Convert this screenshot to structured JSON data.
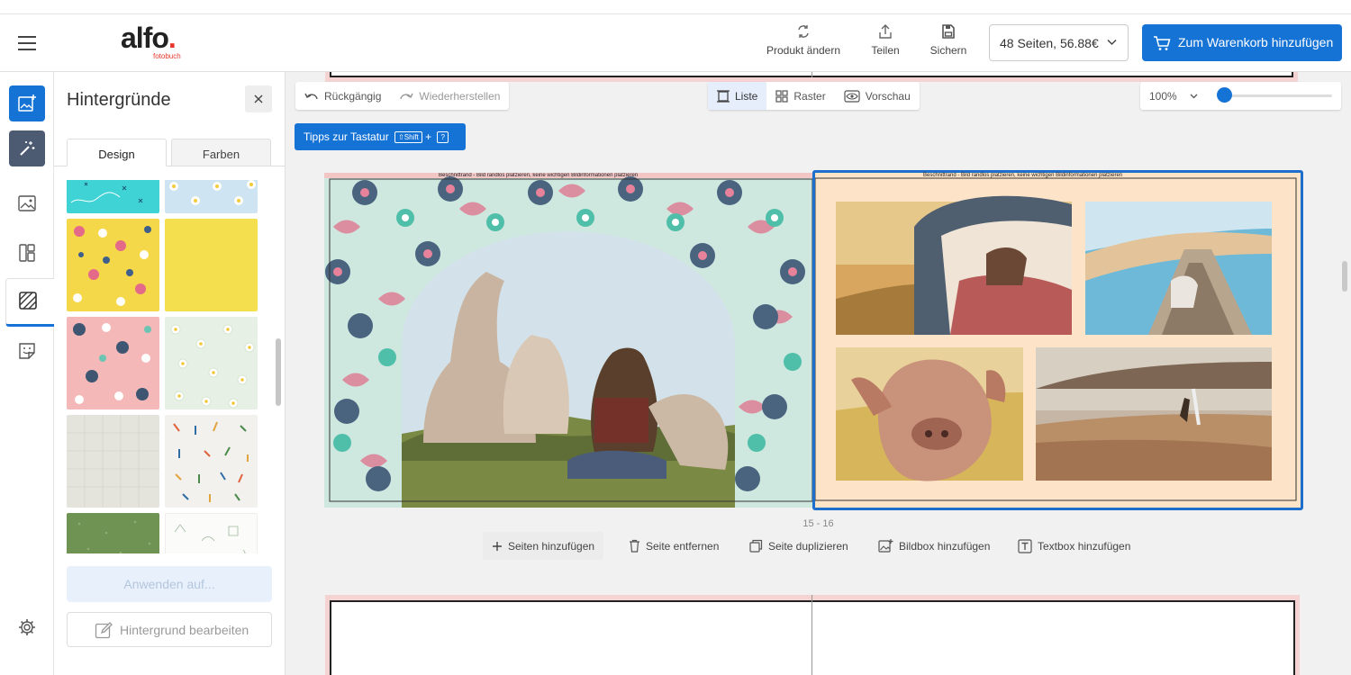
{
  "app": {
    "logo_text": "alfo",
    "logo_dot": ".",
    "logo_sub": "fotobuch"
  },
  "header": {
    "change_product_label": "Produkt ändern",
    "share_label": "Teilen",
    "save_label": "Sichern",
    "pages_price_value": "48 Seiten, 56.88€",
    "add_to_cart_label": "Zum Warenkorb hinzufügen"
  },
  "side_panel": {
    "title": "Hintergründe",
    "tabs": [
      {
        "label": "Design",
        "active": true
      },
      {
        "label": "Farben",
        "active": false
      }
    ],
    "thumbnails": [
      {
        "name": "turquoise-doodle",
        "color": "#3fd3d6"
      },
      {
        "name": "blue-daisies",
        "color": "#cfe4f2"
      },
      {
        "name": "yellow-flowers",
        "color": "#f5d74a"
      },
      {
        "name": "solid-yellow",
        "color": "#f4e04f"
      },
      {
        "name": "pink-flowers",
        "color": "#f4b8b8"
      },
      {
        "name": "mint-daisies",
        "color": "#e6f0e4"
      },
      {
        "name": "grey-linen",
        "color": "#e4e3dc"
      },
      {
        "name": "tools-pattern",
        "color": "#f3f1ee"
      },
      {
        "name": "green-dots",
        "color": "#6e9353"
      },
      {
        "name": "white-lineart",
        "color": "#fbfcf9"
      }
    ],
    "apply_label": "Anwenden auf...",
    "edit_background_label": "Hintergrund bearbeiten"
  },
  "toolbar": {
    "undo_label": "Rückgängig",
    "redo_label": "Wiederherstellen",
    "views": [
      {
        "label": "Liste",
        "active": true
      },
      {
        "label": "Raster",
        "active": false
      },
      {
        "label": "Vorschau",
        "active": false
      }
    ],
    "zoom_value": "100%",
    "zoom_level": 0.0,
    "tips_label": "Tipps zur Tastatur",
    "tips_key_shift": "⇧Shift",
    "tips_plus": "+",
    "tips_key_q": "?"
  },
  "spread": {
    "bleed_note_left": "Beschnittrand - Bild randlos platzieren, keine wichtigen Bildinformationen platzieren",
    "bleed_note_right": "Beschnittrand - Bild randlos platzieren, keine wichtigen Bildinformationen platzieren",
    "page_numbers": "15 - 16"
  },
  "page_actions": {
    "add_pages": "Seiten hinzufügen",
    "remove_page": "Seite entfernen",
    "duplicate_page": "Seite duplizieren",
    "add_image_box": "Bildbox hinzufügen",
    "add_text_box": "Textbox hinzufügen"
  },
  "colors": {
    "accent": "#1673d6",
    "page_left_bg": "#cfe8df",
    "page_right_bg": "#fde4c8",
    "bleed_pink": "#f6d3d3"
  }
}
